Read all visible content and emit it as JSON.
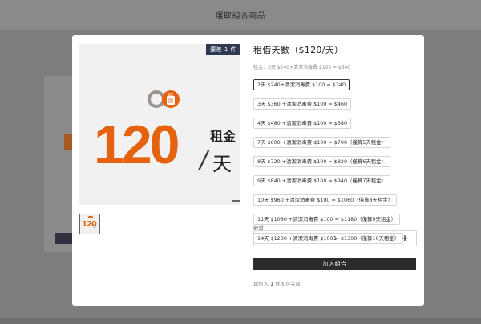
{
  "page": {
    "header_title": "選取組合商品"
  },
  "product": {
    "stock_badge": "還差 1 件",
    "image": {
      "number": "120",
      "rent_label": "租金",
      "day_label": "天",
      "slash": "/"
    },
    "thumbnail": {
      "number": "120",
      "sub": "天"
    }
  },
  "details": {
    "title": "租借天數（$120/天）",
    "subtitle": "租金：2天 $240+清潔消毒費 $100 = $340",
    "options": [
      {
        "label": "2天 $240+清潔消毒費 $100 = $340",
        "selected": true
      },
      {
        "label": "3天 $360 +清潔消毒費 $100 = $460",
        "selected": false
      },
      {
        "label": "4天 $480 +清潔消毒費 $100 = $580",
        "selected": false
      },
      {
        "label": "7天 $600 +清潔消毒費 $100 = $700（僅算5天租金）",
        "selected": false
      },
      {
        "label": "8天 $720 +清潔消毒費 $100 = $820（僅算6天租金）",
        "selected": false
      },
      {
        "label": "9天 $840 +清潔消毒費 $100 = $940（僅算7天租金）",
        "selected": false
      },
      {
        "label": "10天 $960 +清潔消毒費 $100 = $1060（僅算8天租金）",
        "selected": false
      },
      {
        "label": "11天 $1080 +清潔消毒費 $100 = $1180（僅算9天租金）",
        "selected": false
      },
      {
        "label": "14天 $1200 +清潔消毒費 $100 = $1300（僅算10天租金）",
        "selected": false
      }
    ],
    "quantity_label": "數量",
    "quantity_value": "1",
    "minus": "−",
    "plus": "+",
    "add_button": "加入組合",
    "hint_prefix": "再加入",
    "hint_count": "1",
    "hint_suffix": "件即可完成"
  },
  "colors": {
    "accent": "#e5630f",
    "badge": "#2f3a52",
    "button": "#2b2b2b"
  }
}
